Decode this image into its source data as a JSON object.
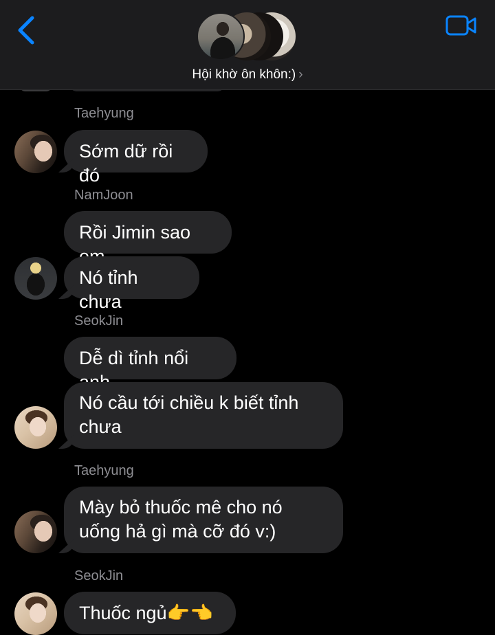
{
  "header": {
    "group_name": "Hội khờ ôn khôn:)",
    "chevron": "›",
    "back_icon": "chevron-left-icon",
    "video_icon": "video-camera-icon",
    "accent_color": "#0a84ff",
    "background": "#1c1c1e"
  },
  "messages": [
    {
      "sender": "Taehyung",
      "bubbles": [
        "Sớm dữ rồi đó"
      ]
    },
    {
      "sender": "NamJoon",
      "bubbles": [
        "Rồi Jimin sao em",
        "Nó tỉnh chưa"
      ]
    },
    {
      "sender": "SeokJin",
      "bubbles": [
        "Dễ dì tỉnh nổi anh",
        "Nó cầu tới chiều k biết tỉnh chưa"
      ]
    },
    {
      "sender": "Taehyung",
      "bubbles": [
        "Mày bỏ thuốc mê cho nó uống hả gì mà cỡ đó v:)"
      ]
    },
    {
      "sender": "SeokJin",
      "bubbles": [
        "Thuốc ngủ👉👈"
      ]
    }
  ],
  "colors": {
    "chat_background": "#000000",
    "bubble": "#262628",
    "sender_name": "#8e8e93"
  }
}
